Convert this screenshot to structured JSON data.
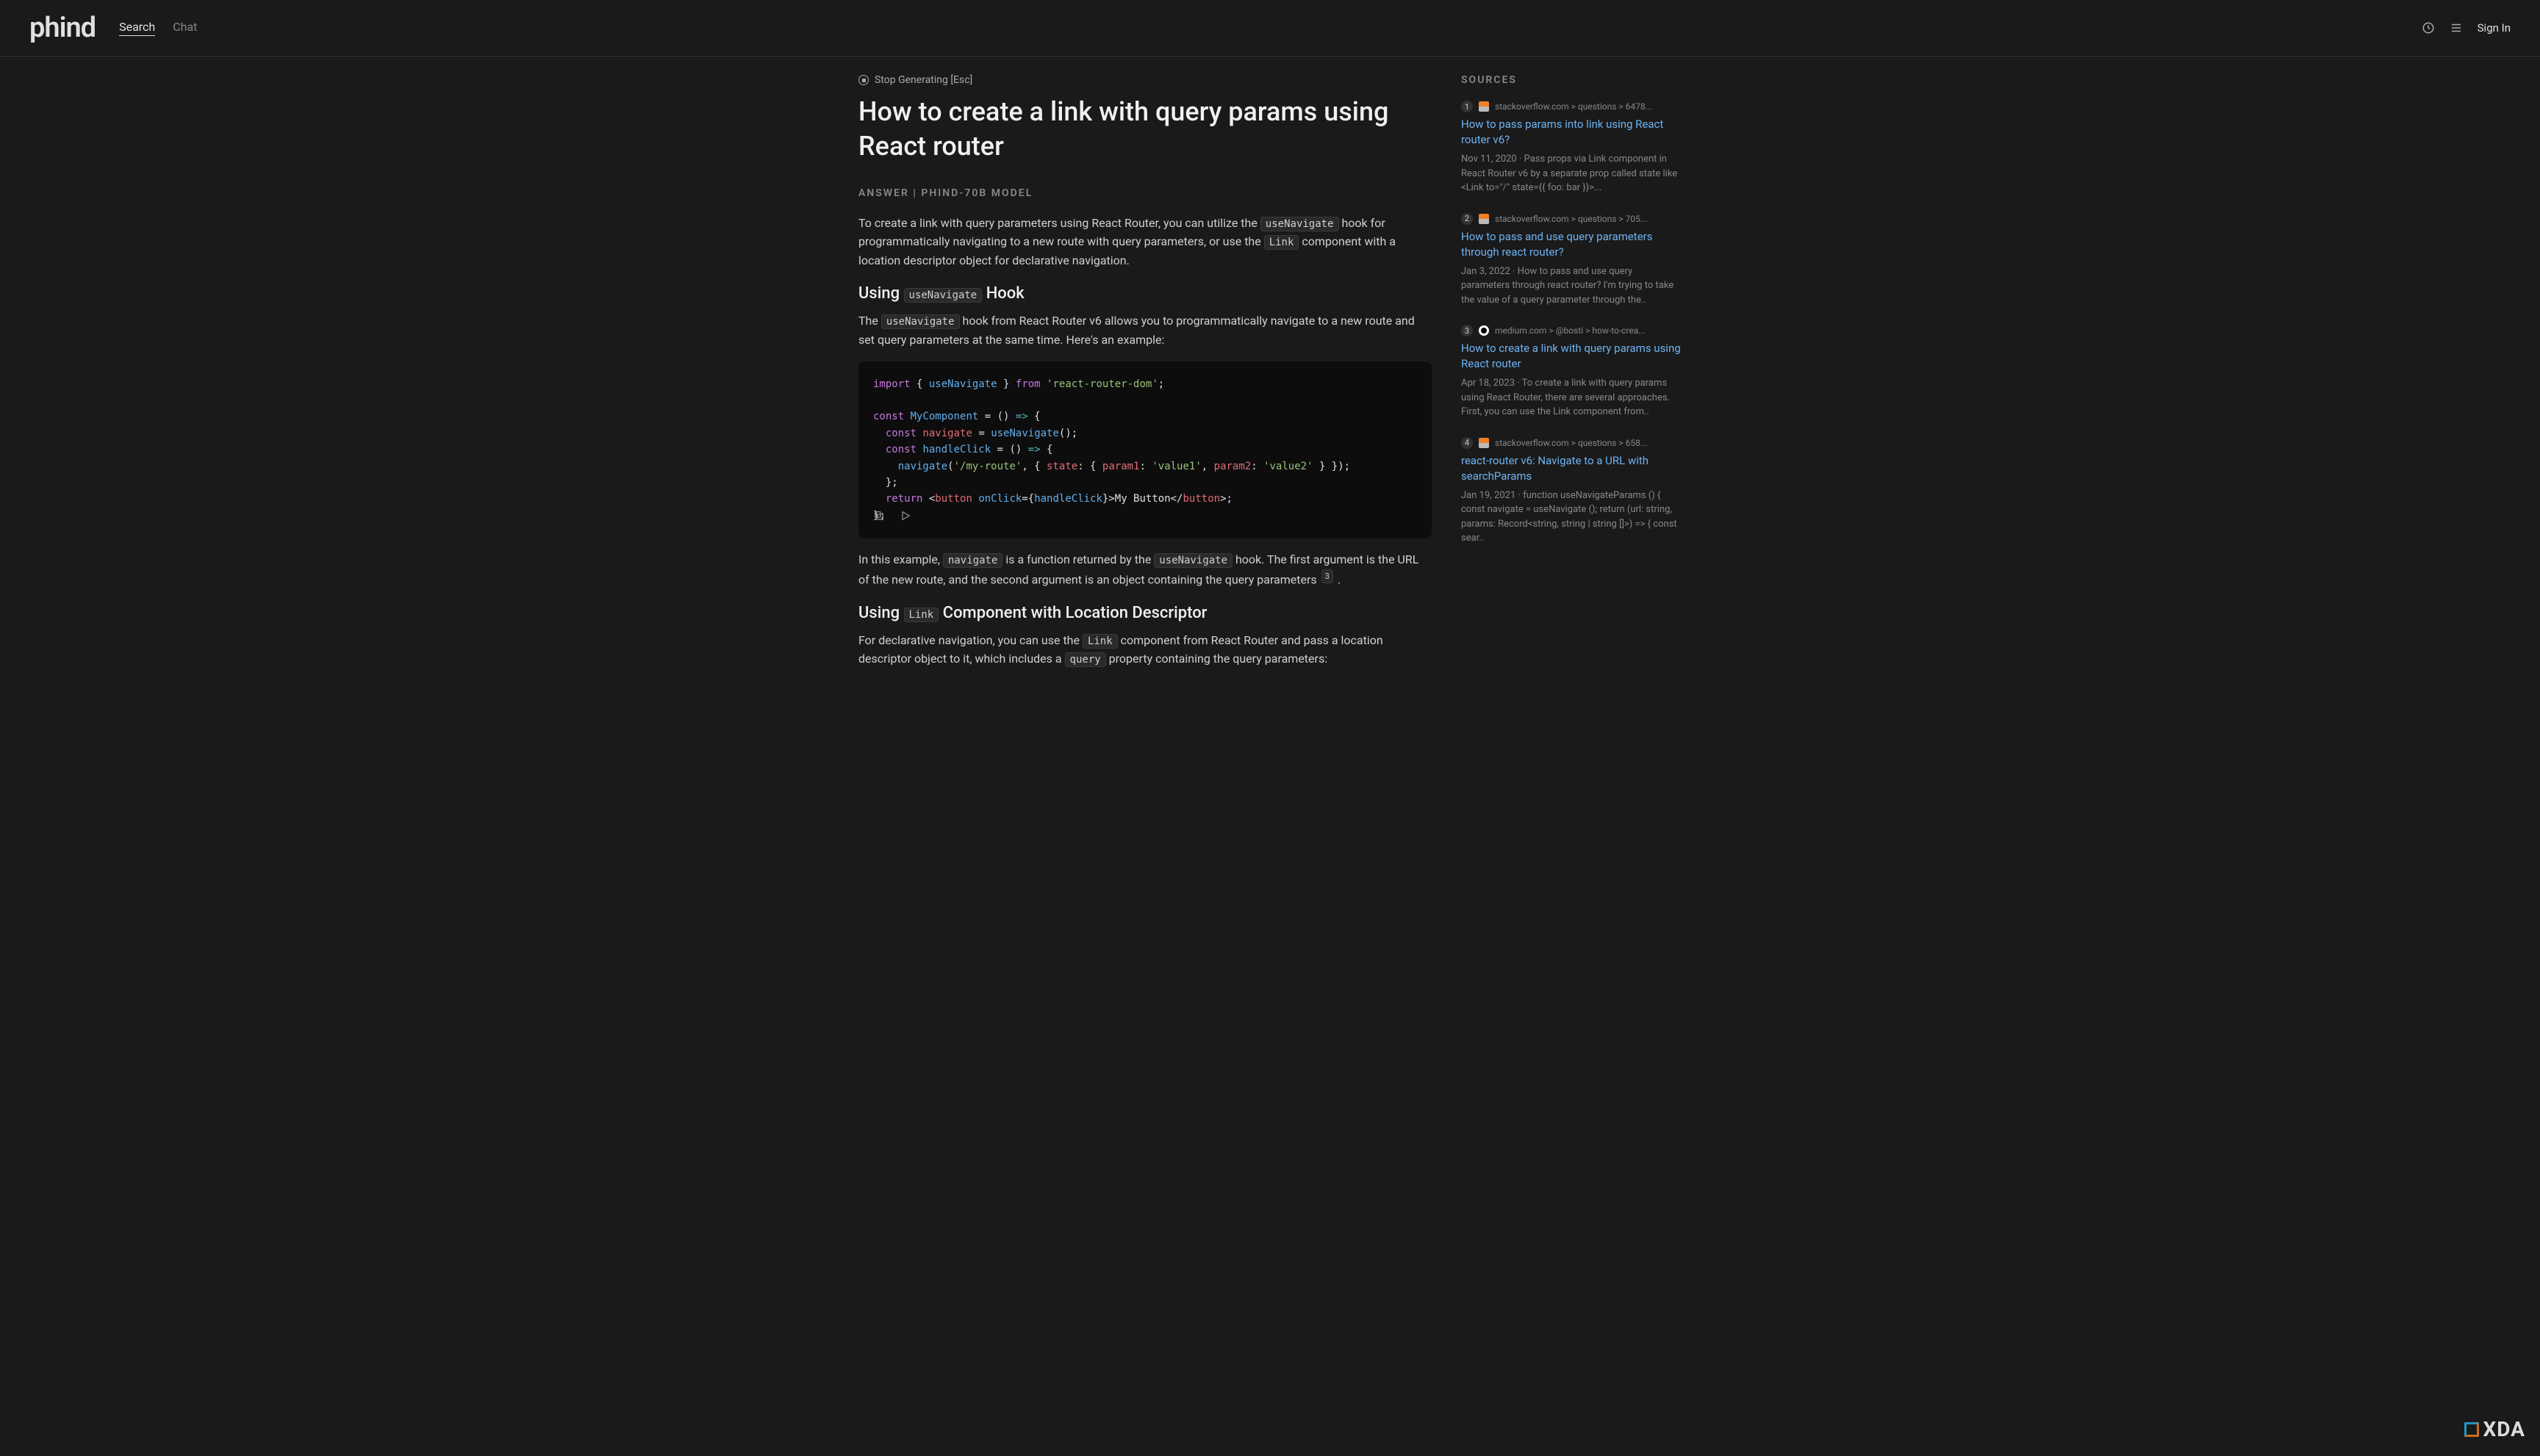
{
  "header": {
    "logo": "phind",
    "nav": {
      "search": "Search",
      "chat": "Chat"
    },
    "signin": "Sign In"
  },
  "stop": "Stop Generating [Esc]",
  "title": "How to create a link with query params using React router",
  "answer_label": "ANSWER | PHIND-70B MODEL",
  "p1_a": "To create a link with query parameters using React Router, you can utilize the ",
  "p1_code1": "useNavigate",
  "p1_b": " hook for programmatically navigating to a new route with query parameters, or use the ",
  "p1_code2": "Link",
  "p1_c": " component with a location descriptor object for declarative navigation.",
  "h2_1_a": "Using ",
  "h2_1_code": "useNavigate",
  "h2_1_b": " Hook",
  "p2_a": "The ",
  "p2_code": "useNavigate",
  "p2_b": " hook from React Router v6 allows you to programmatically navigate to a new route and set query parameters at the same time. Here's an example:",
  "code": "import { useNavigate } from 'react-router-dom';\n\nconst MyComponent = () => {\n  const navigate = useNavigate();\n  const handleClick = () => {\n    navigate('/my-route', { state: { param1: 'value1', param2: 'value2' } });\n  };\n  return <button onClick={handleClick}>My Button</button>;\n};",
  "p3_a": "In this example, ",
  "p3_code1": "navigate",
  "p3_b": " is a function returned by the ",
  "p3_code2": "useNavigate",
  "p3_c": " hook. The first argument is the URL of the new route, and the second argument is an object containing the query parameters ",
  "p3_badge": "3",
  "p3_d": " .",
  "h2_2_a": "Using ",
  "h2_2_code": "Link",
  "h2_2_b": " Component with Location Descriptor",
  "p4_a": "For declarative navigation, you can use the ",
  "p4_code1": "Link",
  "p4_b": " component from React Router and pass a location descriptor object to it, which includes a ",
  "p4_code2": "query",
  "p4_c": " property containing the query parameters:",
  "sources_label": "SOURCES",
  "sources": [
    {
      "num": "1",
      "url": "stackoverflow.com > questions > 6478...",
      "title": "How to pass params into link using React router v6?",
      "snippet": "Nov 11, 2020 · Pass props via Link component in React Router v6 by a separate prop called state like <Link to=\"/\" state={{ foo: bar }}>..."
    },
    {
      "num": "2",
      "url": "stackoverflow.com > questions > 705...",
      "title": "How to pass and use query parameters through react router?",
      "snippet": "Jan 3, 2022 · How to pass and use query parameters through react router? I'm trying to take the value of a query parameter through the.."
    },
    {
      "num": "3",
      "url": "medium.com > @bosti > how-to-crea...",
      "title": "How to create a link with query params using React router",
      "snippet": "Apr 18, 2023 · To create a link with query params using React Router, there are several approaches. First, you can use the Link component from.."
    },
    {
      "num": "4",
      "url": "stackoverflow.com > questions > 658...",
      "title": "react-router v6: Navigate to a URL with searchParams",
      "snippet": "Jan 19, 2021 · function useNavigateParams () { const navigate = useNavigate (); return (url: string, params: Record<string, string | string []>) => { const sear.."
    }
  ],
  "watermark": "XDA"
}
